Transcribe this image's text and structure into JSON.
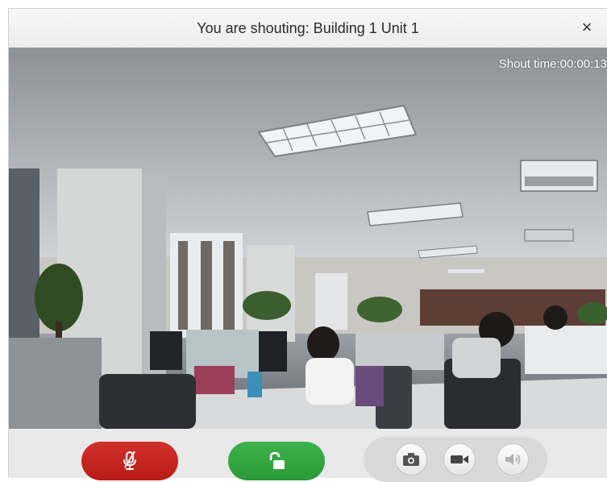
{
  "dialog": {
    "title": "You are shouting: Building 1 Unit 1",
    "close_glyph": "×"
  },
  "video": {
    "shout_time": "Shout time:00:00:13"
  },
  "toolbar": {
    "mute": {
      "icon": "microphone-muted-icon",
      "color": "#c8241f"
    },
    "unlock": {
      "icon": "unlock-icon",
      "color": "#35a843"
    },
    "snapshot": {
      "icon": "camera-icon"
    },
    "record": {
      "icon": "video-camera-icon"
    },
    "volume": {
      "icon": "speaker-icon"
    }
  }
}
